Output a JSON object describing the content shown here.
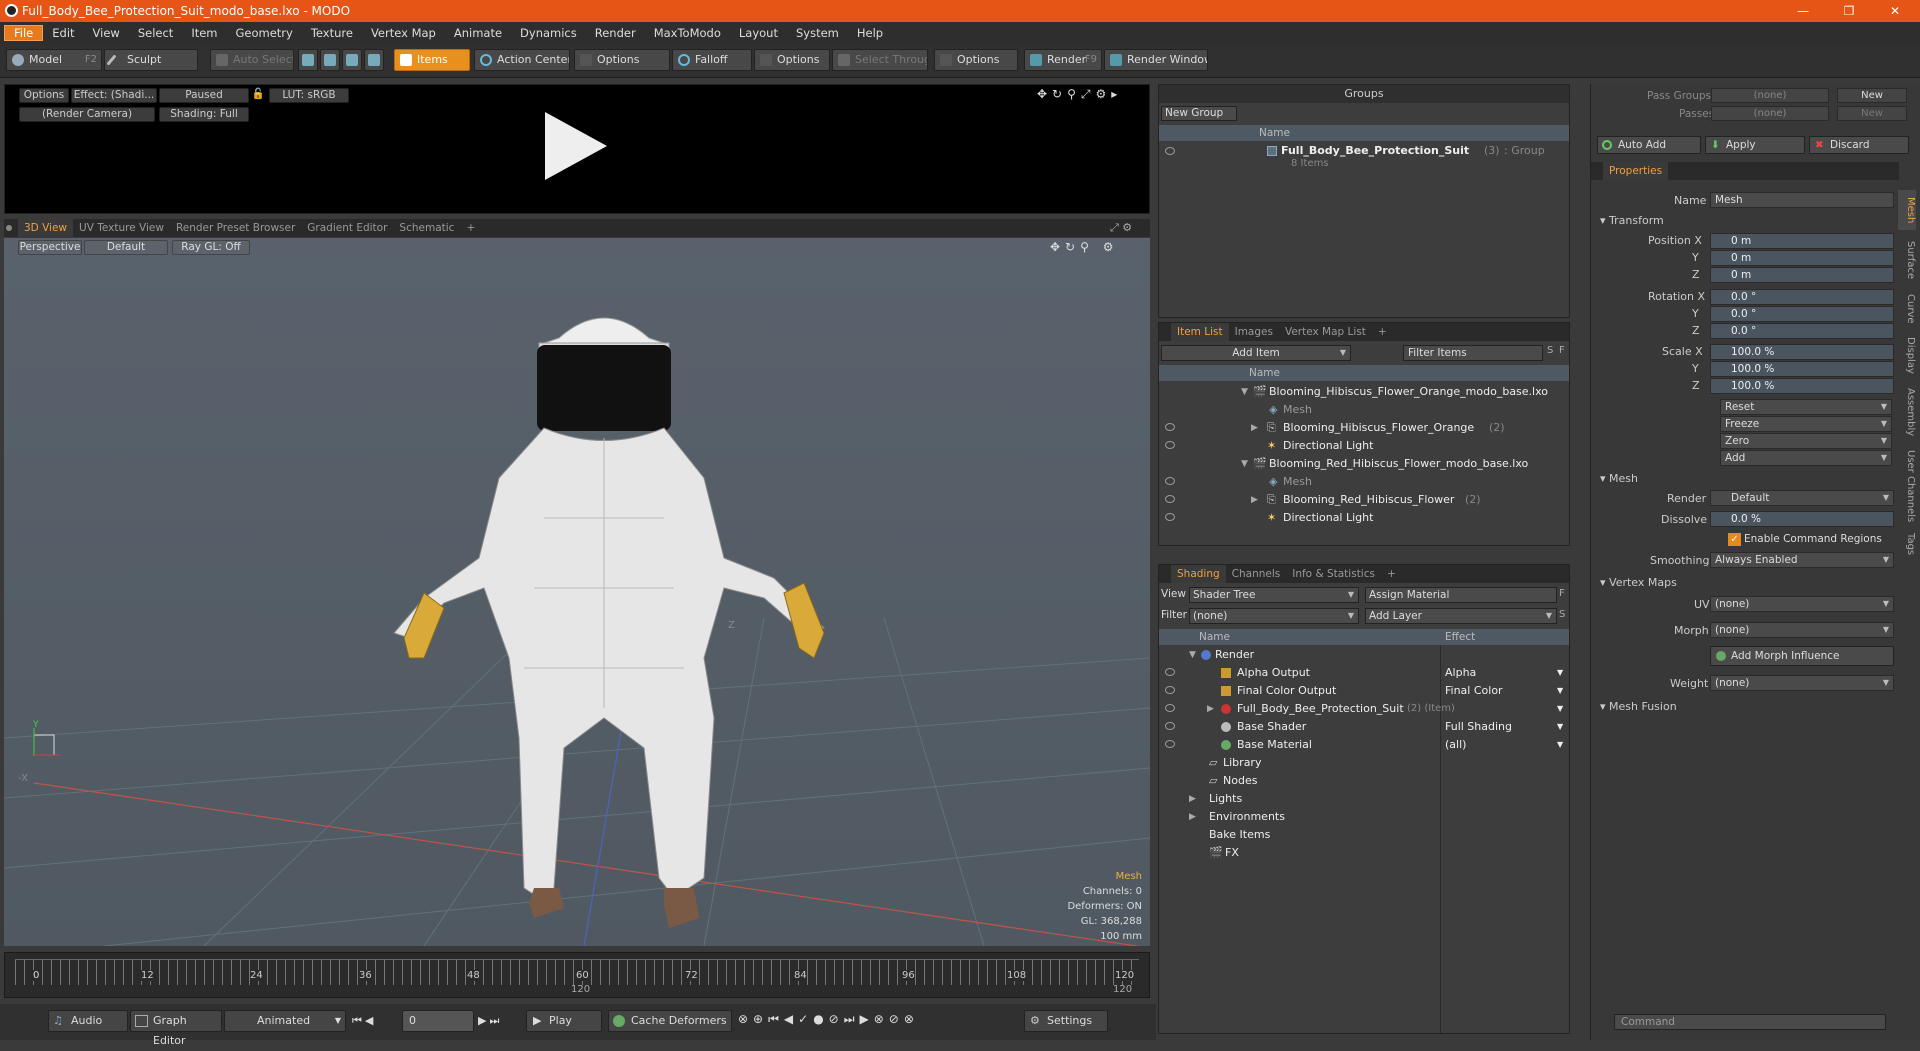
{
  "window": {
    "title": "Full_Body_Bee_Protection_Suit_modo_base.lxo - MODO",
    "min": "—",
    "max": "❐",
    "close": "✕"
  },
  "menu": [
    "File",
    "Edit",
    "View",
    "Select",
    "Item",
    "Geometry",
    "Texture",
    "Vertex Map",
    "Animate",
    "Dynamics",
    "Render",
    "MaxToModo",
    "Layout",
    "System",
    "Help"
  ],
  "toolbar": {
    "model": "Model",
    "model_key": "F2",
    "sculpt": "Sculpt",
    "auto_select": "Auto Select",
    "items": "Items",
    "action_center": "Action Center",
    "options1": "Options",
    "falloff": "Falloff",
    "options2": "Options",
    "select_through": "Select Through",
    "options3": "Options",
    "render": "Render",
    "render_key": "F9",
    "render_window": "Render Window"
  },
  "preview": {
    "options": "Options",
    "effect": "Effect: (Shadi...",
    "paused": "Paused",
    "lut": "LUT: sRGB",
    "camera": "(Render Camera)",
    "shading": "Shading: Full"
  },
  "view_tabs": [
    "3D View",
    "UV Texture View",
    "Render Preset Browser",
    "Gradient Editor",
    "Schematic",
    "+"
  ],
  "viewport": {
    "perspective": "Perspective",
    "default": "Default",
    "raygl": "Ray GL: Off",
    "axis_x": "X",
    "axis_z": "Z",
    "axis_neg_x": "-X",
    "axis_y": "Y",
    "info": {
      "title": "Mesh",
      "channels": "Channels: 0",
      "deformers": "Deformers: ON",
      "gl": "GL: 368,288",
      "scale": "100 mm"
    }
  },
  "timeline": {
    "ticks": [
      "0",
      "12",
      "24",
      "36",
      "48",
      "60",
      "72",
      "84",
      "96",
      "108",
      "120"
    ],
    "mid": "120",
    "end": "120"
  },
  "bottom": {
    "audio": "Audio",
    "graph": "Graph Editor",
    "animated": "Animated",
    "frame": "0",
    "play": "Play",
    "cache": "Cache Deformers",
    "settings": "Settings"
  },
  "groups": {
    "title": "Groups",
    "new_group": "New Group",
    "col_name": "Name",
    "item_name": "Full_Body_Bee_Protection_Suit",
    "item_count": "(3)",
    "item_type": ": Group",
    "item_sub": "8 Items"
  },
  "item_list": {
    "tabs": [
      "Item List",
      "Images",
      "Vertex Map List",
      "+"
    ],
    "add_item": "Add Item",
    "filter": "Filter Items",
    "s": "S",
    "f": "F",
    "col_name": "Name",
    "rows": [
      {
        "label": "Blooming_Hibiscus_Flower_Orange_modo_base.lxo",
        "extra": ""
      },
      {
        "label": "Mesh",
        "extra": ""
      },
      {
        "label": "Blooming_Hibiscus_Flower_Orange",
        "extra": "(2)"
      },
      {
        "label": "Directional Light",
        "extra": ""
      },
      {
        "label": "Blooming_Red_Hibiscus_Flower_modo_base.lxo",
        "extra": ""
      },
      {
        "label": "Mesh",
        "extra": ""
      },
      {
        "label": "Blooming_Red_Hibiscus_Flower",
        "extra": "(2)"
      },
      {
        "label": "Directional Light",
        "extra": ""
      }
    ]
  },
  "shading": {
    "tabs": [
      "Shading",
      "Channels",
      "Info & Statistics",
      "+"
    ],
    "view_label": "View",
    "view_value": "Shader Tree",
    "assign": "Assign Material",
    "f": "F",
    "filter_label": "Filter",
    "filter_value": "(none)",
    "add_layer": "Add Layer",
    "s": "S",
    "col_name": "Name",
    "col_effect": "Effect",
    "rows": [
      {
        "label": "Render",
        "effect": "",
        "extra": ""
      },
      {
        "label": "Alpha Output",
        "effect": "Alpha",
        "extra": ""
      },
      {
        "label": "Final Color Output",
        "effect": "Final Color",
        "extra": ""
      },
      {
        "label": "Full_Body_Bee_Protection_Suit",
        "effect": "",
        "extra": "(2) (Item)"
      },
      {
        "label": "Base Shader",
        "effect": "Full Shading",
        "extra": ""
      },
      {
        "label": "Base Material",
        "effect": "(all)",
        "extra": ""
      },
      {
        "label": "Library",
        "effect": "",
        "extra": ""
      },
      {
        "label": "Nodes",
        "effect": "",
        "extra": ""
      },
      {
        "label": "Lights",
        "effect": "",
        "extra": ""
      },
      {
        "label": "Environments",
        "effect": "",
        "extra": ""
      },
      {
        "label": "Bake Items",
        "effect": "",
        "extra": ""
      },
      {
        "label": "FX",
        "effect": "",
        "extra": ""
      }
    ]
  },
  "props": {
    "pass_groups": "Pass Groups",
    "passes": "Passes",
    "none": "(none)",
    "new": "New",
    "auto_add": "Auto Add",
    "apply": "Apply",
    "discard": "Discard",
    "properties": "Properties",
    "name_label": "Name",
    "name_value": "Mesh",
    "transform": "Transform",
    "pos_label": "Position X",
    "rot_label": "Rotation X",
    "scale_label": "Scale X",
    "y": "Y",
    "z": "Z",
    "pos": [
      "0 m",
      "0 m",
      "0 m"
    ],
    "rot": [
      "0.0 °",
      "0.0 °",
      "0.0 °"
    ],
    "scale": [
      "100.0 %",
      "100.0 %",
      "100.0 %"
    ],
    "reset": "Reset",
    "freeze": "Freeze",
    "zero": "Zero",
    "add": "Add",
    "mesh": "Mesh",
    "render_label": "Render",
    "render_value": "Default",
    "dissolve_label": "Dissolve",
    "dissolve_value": "0.0 %",
    "enable_cmd": "Enable Command Regions",
    "smoothing_label": "Smoothing",
    "smoothing_value": "Always Enabled",
    "vertex_maps": "Vertex Maps",
    "uv_label": "UV",
    "uv_value": "(none)",
    "morph_label": "Morph",
    "morph_value": "(none)",
    "add_morph": "Add Morph Influence",
    "weight_label": "Weight",
    "weight_value": "(none)",
    "mesh_fusion": "Mesh Fusion",
    "vtabs": [
      "Mesh",
      "Surface",
      "Curve",
      "Display",
      "Assembly",
      "User Channels",
      "Tags"
    ],
    "command": "Command"
  }
}
